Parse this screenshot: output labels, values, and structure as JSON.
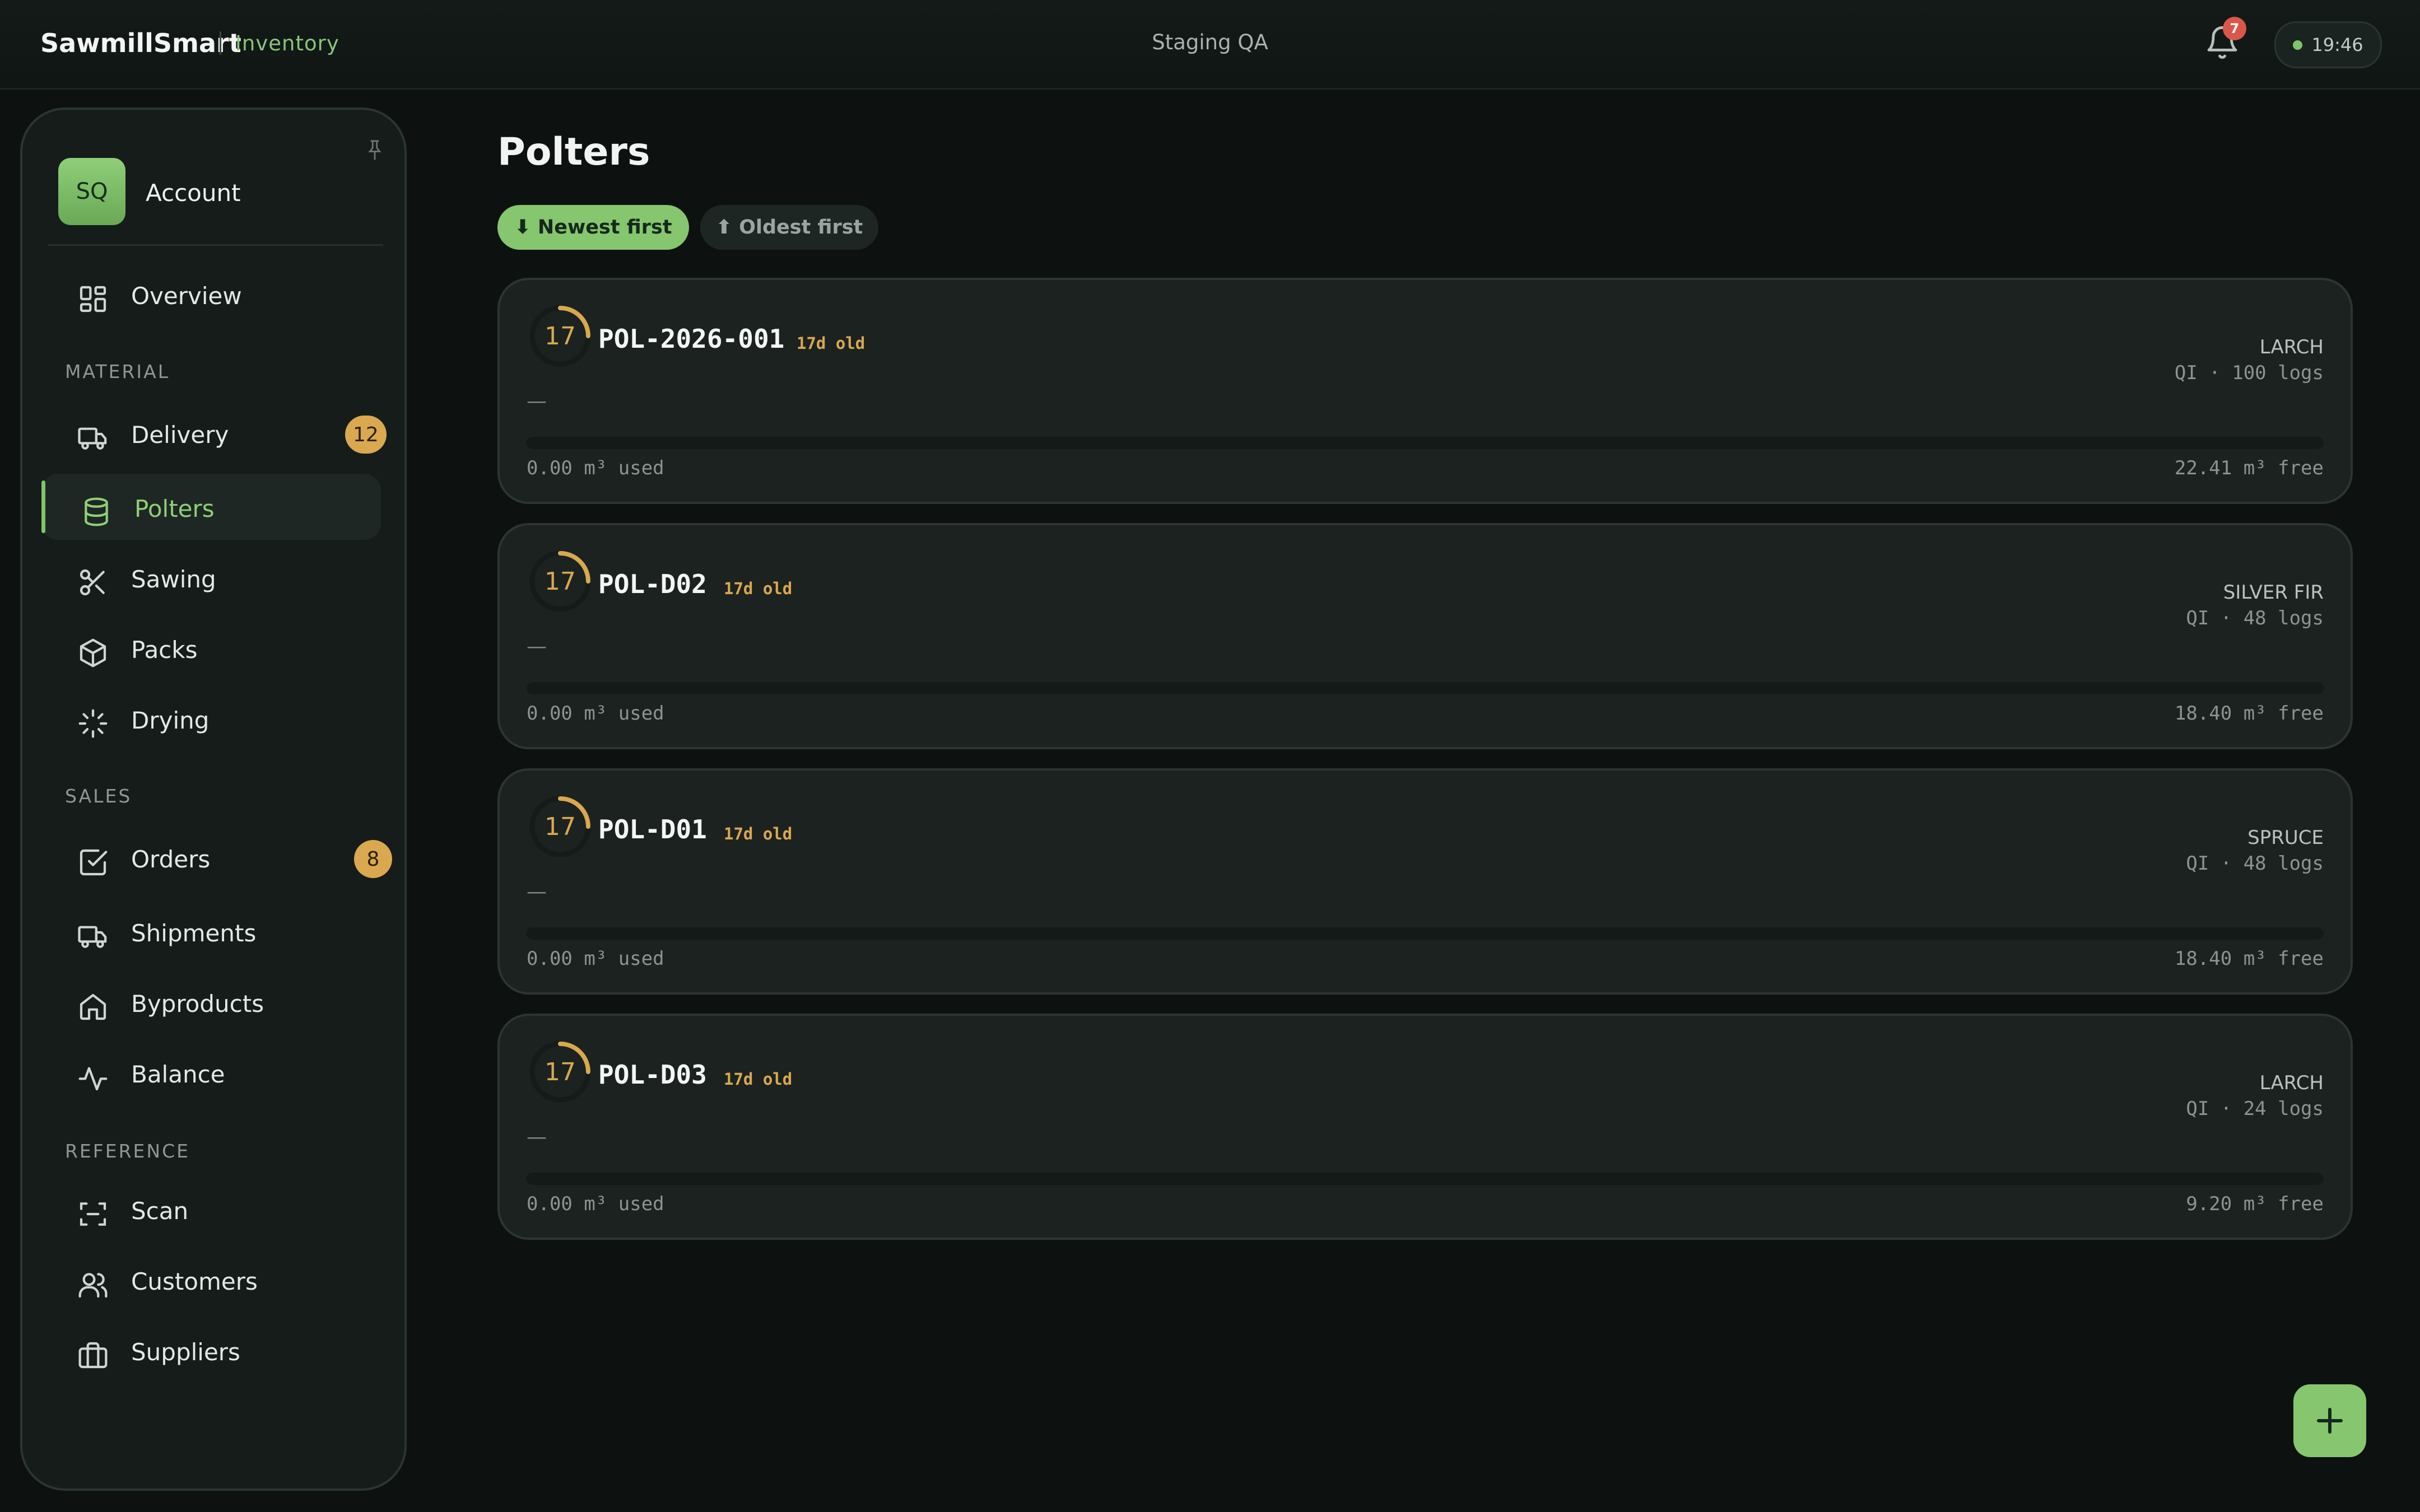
{
  "header": {
    "brand": "SawmillSmart",
    "section": "Inventory",
    "environment": "Staging QA",
    "notification_count": "7",
    "clock": "19:46",
    "status_color": "#7fc46c"
  },
  "sidebar": {
    "account": {
      "initials": "SQ",
      "label": "Account"
    },
    "overview": {
      "label": "Overview",
      "icon": "grid-icon"
    },
    "sections": {
      "material": "MATERIAL",
      "sales": "SALES",
      "reference": "REFERENCE"
    },
    "material_items": [
      {
        "label": "Delivery",
        "icon": "truck-icon",
        "badge": "12"
      },
      {
        "label": "Polters",
        "icon": "database-icon",
        "active": true
      },
      {
        "label": "Sawing",
        "icon": "scissors-icon"
      },
      {
        "label": "Packs",
        "icon": "box-icon"
      },
      {
        "label": "Drying",
        "icon": "loader-icon"
      }
    ],
    "sales_items": [
      {
        "label": "Orders",
        "icon": "check-square-icon",
        "badge": "8"
      },
      {
        "label": "Shipments",
        "icon": "truck-icon"
      },
      {
        "label": "Byproducts",
        "icon": "home-icon"
      },
      {
        "label": "Balance",
        "icon": "activity-icon"
      }
    ],
    "reference_items": [
      {
        "label": "Scan",
        "icon": "scan-icon"
      },
      {
        "label": "Customers",
        "icon": "users-icon"
      },
      {
        "label": "Suppliers",
        "icon": "briefcase-icon"
      }
    ]
  },
  "main": {
    "title": "Polters",
    "sort": {
      "newest": "⬇ Newest first",
      "oldest": "⬆ Oldest first",
      "selected": "newest"
    },
    "polters": [
      {
        "age_days": "17",
        "id": "POL-2026-001",
        "age_label": "17d old",
        "species": "LARCH",
        "meta": "QI · 100 logs",
        "note": "—",
        "used": "0.00 m³ used",
        "free": "22.41 m³ free",
        "used_fraction": 0
      },
      {
        "age_days": "17",
        "id": "POL-D02",
        "age_label": "17d old",
        "species": "SILVER FIR",
        "meta": "QI · 48 logs",
        "note": "—",
        "used": "0.00 m³ used",
        "free": "18.40 m³ free",
        "used_fraction": 0
      },
      {
        "age_days": "17",
        "id": "POL-D01",
        "age_label": "17d old",
        "species": "SPRUCE",
        "meta": "QI · 48 logs",
        "note": "—",
        "used": "0.00 m³ used",
        "free": "18.40 m³ free",
        "used_fraction": 0
      },
      {
        "age_days": "17",
        "id": "POL-D03",
        "age_label": "17d old",
        "species": "LARCH",
        "meta": "QI · 24 logs",
        "note": "—",
        "used": "0.00 m³ used",
        "free": "9.20 m³ free",
        "used_fraction": 0
      }
    ]
  },
  "colors": {
    "accent": "#86c66f",
    "warning": "#d9a84f",
    "badge_red": "#d9574a"
  }
}
